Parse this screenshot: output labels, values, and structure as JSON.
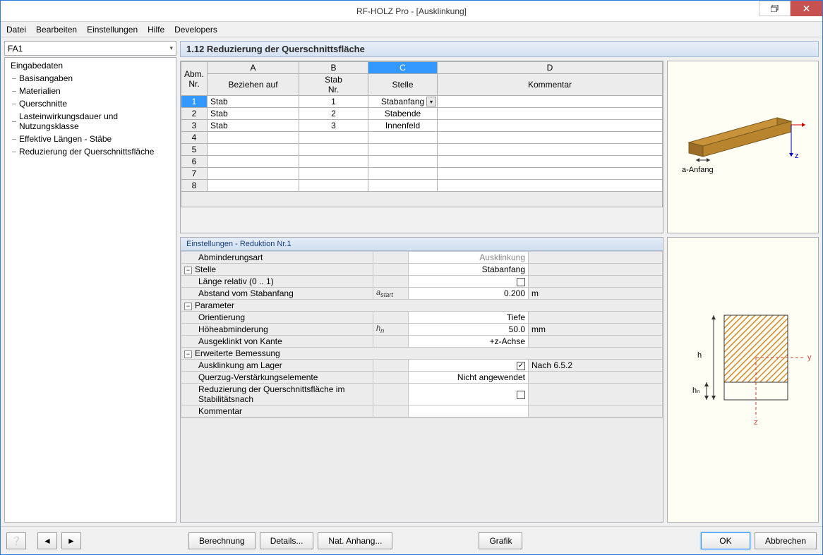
{
  "window": {
    "title": "RF-HOLZ Pro - [Ausklinkung]"
  },
  "menu": {
    "file": "Datei",
    "edit": "Bearbeiten",
    "settings": "Einstellungen",
    "help": "Hilfe",
    "dev": "Developers"
  },
  "sidebar": {
    "combo": "FA1",
    "root": "Eingabedaten",
    "items": [
      "Basisangaben",
      "Materialien",
      "Querschnitte",
      "Lasteinwirkungsdauer und Nutzungsklasse",
      "Effektive Längen - Stäbe",
      "Reduzierung der Querschnittsfläche"
    ]
  },
  "section": {
    "title": "1.12 Reduzierung der Querschnittsfläche"
  },
  "grid": {
    "corner1": "Abm.",
    "corner2": "Nr.",
    "cols": [
      "A",
      "B",
      "C",
      "D"
    ],
    "headers": [
      "Beziehen auf",
      "Stab\nNr.",
      "Stelle",
      "Kommentar"
    ],
    "h1": "Beziehen auf",
    "h2a": "Stab",
    "h2b": "Nr.",
    "h3": "Stelle",
    "h4": "Kommentar",
    "rows": [
      {
        "n": "1",
        "a": "Stab",
        "b": "1",
        "c": "Stabanfang",
        "d": ""
      },
      {
        "n": "2",
        "a": "Stab",
        "b": "2",
        "c": "Stabende",
        "d": ""
      },
      {
        "n": "3",
        "a": "Stab",
        "b": "3",
        "c": "Innenfeld",
        "d": ""
      },
      {
        "n": "4",
        "a": "",
        "b": "",
        "c": "",
        "d": ""
      },
      {
        "n": "5",
        "a": "",
        "b": "",
        "c": "",
        "d": ""
      },
      {
        "n": "6",
        "a": "",
        "b": "",
        "c": "",
        "d": ""
      },
      {
        "n": "7",
        "a": "",
        "b": "",
        "c": "",
        "d": ""
      },
      {
        "n": "8",
        "a": "",
        "b": "",
        "c": "",
        "d": ""
      }
    ]
  },
  "diagram1": {
    "label": "a-Anfang",
    "z": "z"
  },
  "props": {
    "title": "Einstellungen - Reduktion Nr.1",
    "rows": {
      "abmind": {
        "label": "Abminderungsart",
        "val": "Ausklinkung"
      },
      "stelle": {
        "label": "Stelle",
        "val": "Stabanfang"
      },
      "lrel": {
        "label": "Länge relativ (0 .. 1)"
      },
      "abst": {
        "label": "Abstand vom Stabanfang",
        "sym": "a start",
        "val": "0.200",
        "unit": "m"
      },
      "param": {
        "label": "Parameter"
      },
      "orient": {
        "label": "Orientierung",
        "val": "Tiefe"
      },
      "hoehe": {
        "label": "Höheabminderung",
        "sym": "h n",
        "val": "50.0",
        "unit": "mm"
      },
      "ausg": {
        "label": "Ausgeklinkt von Kante",
        "val": "+z-Achse"
      },
      "erw": {
        "label": "Erweiterte Bemessung"
      },
      "lager": {
        "label": "Ausklinkung am Lager",
        "unit": "Nach 6.5.2"
      },
      "quer": {
        "label": "Querzug-Verstärkungselemente",
        "val": "Nicht angewendet"
      },
      "redstab": {
        "label": "Reduzierung der Querschnittsfläche im Stabilitätsnach"
      },
      "komm": {
        "label": "Kommentar"
      }
    }
  },
  "diagram2": {
    "h": "h",
    "hn": "hₙ",
    "y": "y",
    "z": "z"
  },
  "footer": {
    "calc": "Berechnung",
    "details": "Details...",
    "nat": "Nat. Anhang...",
    "grafik": "Grafik",
    "ok": "OK",
    "cancel": "Abbrechen"
  }
}
